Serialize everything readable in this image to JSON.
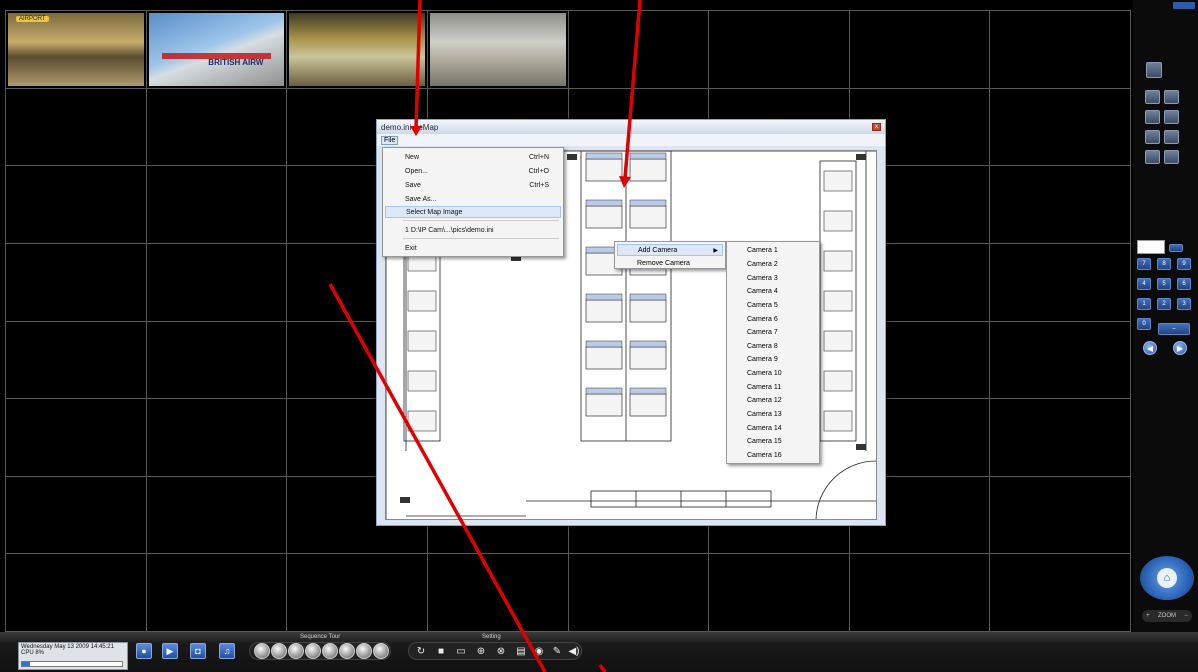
{
  "emap_window": {
    "title": "demo.ini - eMap",
    "close_glyph": "x",
    "menubar": {
      "file_label": "File"
    }
  },
  "file_menu": {
    "items": [
      {
        "label": "New",
        "shortcut": "Ctrl+N"
      },
      {
        "label": "Open...",
        "shortcut": "Ctrl+O"
      },
      {
        "label": "Save",
        "shortcut": "Ctrl+S"
      },
      {
        "label": "Save As...",
        "shortcut": ""
      },
      {
        "label": "Select Map Image",
        "shortcut": ""
      },
      {
        "label": "1 D:\\IP Cam\\...\\pics\\demo.ini",
        "shortcut": ""
      },
      {
        "label": "Exit",
        "shortcut": ""
      }
    ],
    "highlighted": "Select Map Image"
  },
  "context_menu": {
    "items": [
      {
        "label": "Add Camera",
        "has_submenu": true
      },
      {
        "label": "Remove Camera",
        "has_submenu": false
      }
    ],
    "highlighted": "Add Camera"
  },
  "camera_submenu": {
    "items": [
      "Camera 1",
      "Camera 2",
      "Camera 3",
      "Camera 4",
      "Camera 5",
      "Camera 6",
      "Camera 7",
      "Camera 8",
      "Camera 9",
      "Camera 10",
      "Camera 11",
      "Camera 12",
      "Camera 13",
      "Camera 14",
      "Camera 15",
      "Camera 16"
    ]
  },
  "thumbnails": {
    "cam2_text": "BRITISH AIRW",
    "cam1_tag": "AIRPORT"
  },
  "status_bar": {
    "datetime": "Wednesday May 13 2009 14:45:21",
    "cpu_label": "CPU 8%",
    "cpu_percent": 8,
    "sequence_tour_label": "Sequence Tour",
    "setting_label": "Setting"
  },
  "right_panel": {
    "zoom_label": "ZOOM",
    "keypad": [
      "7",
      "8",
      "9",
      "4",
      "5",
      "6",
      "1",
      "2",
      "3",
      "0"
    ]
  },
  "colors": {
    "accent_blue": "#2b64b8",
    "annotation_red": "#e00000",
    "highlight": "#dce8f7"
  }
}
